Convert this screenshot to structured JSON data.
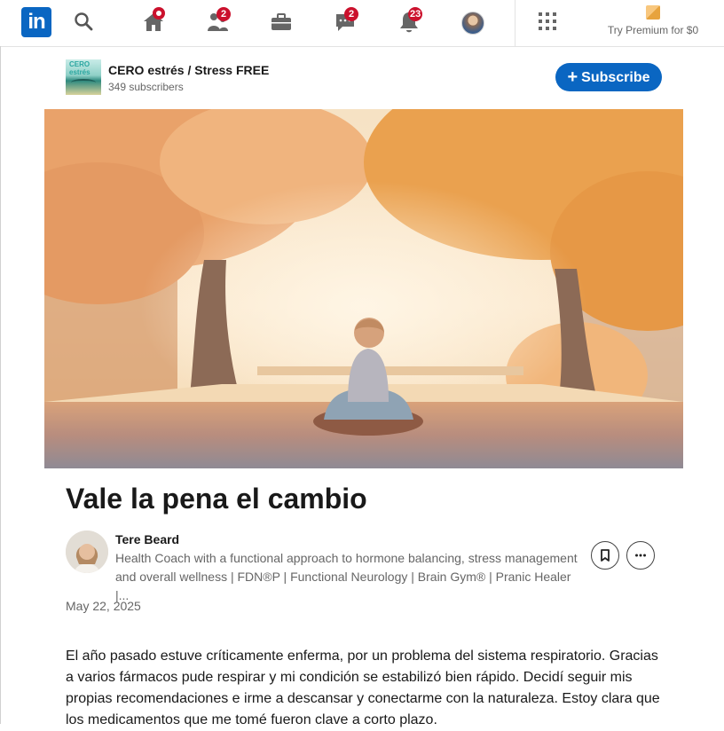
{
  "nav": {
    "logo_text": "in",
    "home_badge": "",
    "network_badge": "2",
    "messaging_badge": "2",
    "notifications_badge": "23",
    "premium_label": "Try Premium for $0"
  },
  "newsletter": {
    "logo_text": "CERO estrés",
    "name": "CERO estrés / Stress FREE",
    "subscribers": "349 subscribers",
    "subscribe_label": "Subscribe"
  },
  "article": {
    "title": "Vale la pena el cambio",
    "author_name": "Tere Beard",
    "author_headline": "Health Coach with a functional approach to hormone balancing, stress management and overall wellness | FDN®P | Functional Neurology | Brain Gym® | Pranic Healer |...",
    "date": "May 22, 2025",
    "body": "El año pasado estuve críticamente enferma, por un problema del sistema respiratorio. Gracias a varios fármacos pude respirar y mi condición se estabilizó bien rápido. Decidí seguir mis propias recomendaciones e irme a descansar y conectarme con la naturaleza. Estoy clara que los medicamentos que me tomé fueron clave a corto plazo."
  },
  "colors": {
    "brand_blue": "#0a66c2",
    "badge_red": "#cb112d",
    "muted_text": "#666666"
  },
  "icons": {
    "home": "home-icon",
    "search": "search-icon",
    "network": "people-icon",
    "jobs": "briefcase-icon",
    "messaging": "chat-icon",
    "notifications": "bell-icon",
    "apps": "grid-icon",
    "save": "bookmark-icon",
    "more": "ellipsis-icon"
  }
}
